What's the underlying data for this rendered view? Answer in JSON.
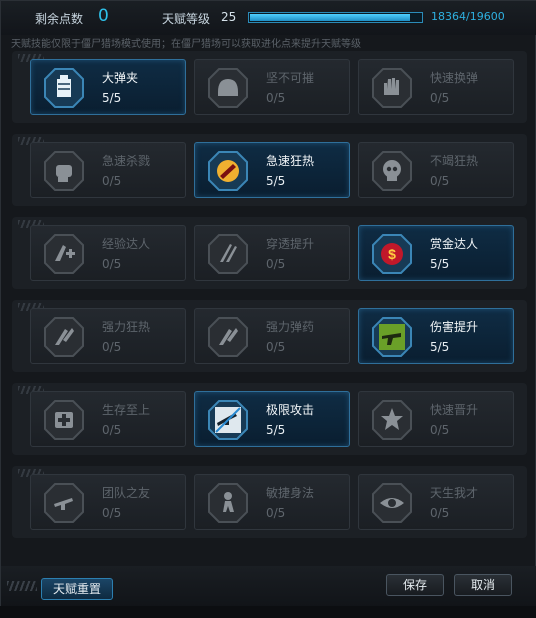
{
  "header": {
    "points_label": "剩余点数",
    "points_value": "0",
    "level_label": "天赋等级",
    "level_value": "25",
    "exp_text": "18364/19600",
    "exp_progress": 0.937,
    "hint": "天赋技能仅限于僵尸猎场模式使用；在僵尸猎场可以获取进化点来提升天赋等级"
  },
  "skills": [
    [
      {
        "name": "大弹夹",
        "level": "5/5",
        "active": true,
        "icon": "magazine-icon"
      },
      {
        "name": "坚不可摧",
        "level": "0/5",
        "active": false,
        "icon": "helmet-icon"
      },
      {
        "name": "快速换弹",
        "level": "0/5",
        "active": false,
        "icon": "hand-reload-icon"
      }
    ],
    [
      {
        "name": "急速杀戮",
        "level": "0/5",
        "active": false,
        "icon": "fist-icon"
      },
      {
        "name": "急速狂热",
        "level": "5/5",
        "active": true,
        "icon": "frenzy-icon"
      },
      {
        "name": "不竭狂热",
        "level": "0/5",
        "active": false,
        "icon": "skull-icon"
      }
    ],
    [
      {
        "name": "经验达人",
        "level": "0/5",
        "active": false,
        "icon": "exp-plus-icon"
      },
      {
        "name": "穿透提升",
        "level": "0/5",
        "active": false,
        "icon": "pierce-icon"
      },
      {
        "name": "赏金达人",
        "level": "5/5",
        "active": true,
        "icon": "dollar-icon"
      }
    ],
    [
      {
        "name": "强力狂热",
        "level": "0/5",
        "active": false,
        "icon": "power-frenzy-icon"
      },
      {
        "name": "强力弹药",
        "level": "0/5",
        "active": false,
        "icon": "power-ammo-icon"
      },
      {
        "name": "伤害提升",
        "level": "5/5",
        "active": true,
        "icon": "gun-damage-icon"
      }
    ],
    [
      {
        "name": "生存至上",
        "level": "0/5",
        "active": false,
        "icon": "medkit-icon"
      },
      {
        "name": "极限攻击",
        "level": "5/5",
        "active": true,
        "icon": "extreme-attack-icon"
      },
      {
        "name": "快速晋升",
        "level": "0/5",
        "active": false,
        "icon": "burst-icon"
      }
    ],
    [
      {
        "name": "团队之友",
        "level": "0/5",
        "active": false,
        "icon": "team-gun-icon"
      },
      {
        "name": "敏捷身法",
        "level": "0/5",
        "active": false,
        "icon": "agile-icon"
      },
      {
        "name": "天生我才",
        "level": "0/5",
        "active": false,
        "icon": "eye-icon"
      }
    ]
  ],
  "footer": {
    "reset_label": "天赋重置",
    "save_label": "保存",
    "cancel_label": "取消"
  },
  "colors": {
    "accent": "#2ec0e8",
    "active_card": "#0f2c44"
  }
}
